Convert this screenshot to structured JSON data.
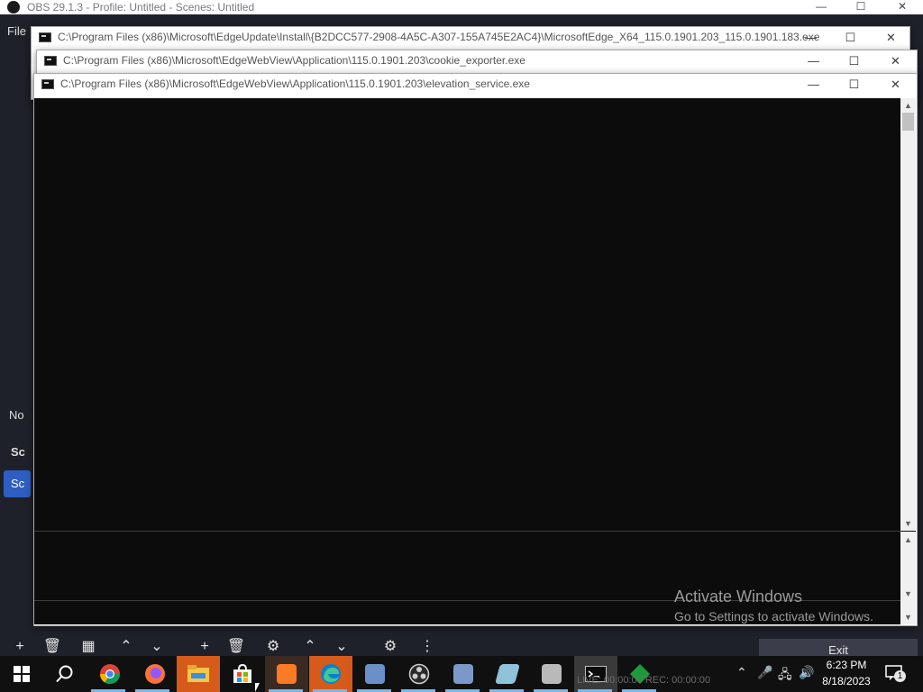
{
  "obs": {
    "title": "OBS 29.1.3 - Profile: Untitled - Scenes: Untitled",
    "menu_file": "File",
    "dock_label_1": "No",
    "dock_label_2": "Sc",
    "dock_label_3": "Sc",
    "exit_label": "Exit",
    "status": "LIVE: 00:00:00   REC: 00:00:00"
  },
  "windows": [
    {
      "title": "C:\\Program Files (x86)\\Microsoft\\EdgeUpdate\\Install\\{B2DCC577-2908-4A5C-A307-155A745E2AC4}\\MicrosoftEdge_X64_115.0.1901.203_115.0.1901.183.exe"
    },
    {
      "title": "C:\\Program Files (x86)\\Microsoft\\EdgeWebView\\Application\\115.0.1901.203\\cookie_exporter.exe"
    },
    {
      "title": "C:\\Program Files (x86)\\Microsoft\\EdgeWebView\\Application\\115.0.1901.203\\elevation_service.exe"
    }
  ],
  "watermark": {
    "line1": "Activate Windows",
    "line2": "Go to Settings to activate Windows."
  },
  "taskbar": {
    "time": "6:23 PM",
    "date": "8/18/2023",
    "notification_count": "1",
    "icons": [
      "windows-start-icon",
      "search-icon",
      "chrome-icon",
      "firefox-icon",
      "file-explorer-icon",
      "store-icon",
      "xampp-icon",
      "edge-icon",
      "app-icon",
      "obs-icon",
      "app-icon",
      "notepad-icon",
      "app-icon",
      "console-icon",
      "green-app-icon"
    ]
  },
  "colors": {
    "console_bg": "#0c0c0c",
    "obs_bg": "#1f212a",
    "accent_blue": "#2f5ec2",
    "taskbar_bg": "#101010"
  }
}
